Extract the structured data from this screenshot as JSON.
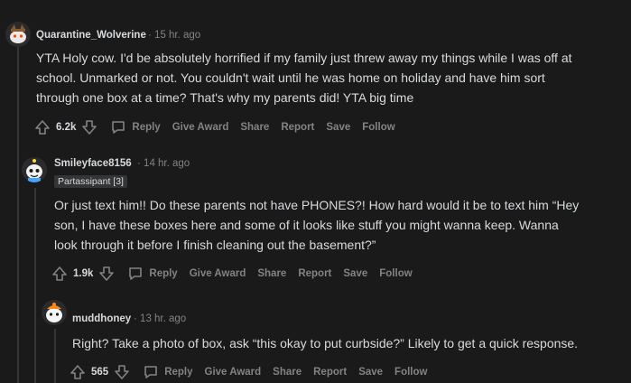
{
  "comments": [
    {
      "author": "Quarantine_Wolverine",
      "time": "15 hr. ago",
      "flair": "",
      "body_lines": [
        "YTA Holy cow. I'd be absolutely horrified if my family just threw away my things while I was off at",
        "school. Unmarked or not. You couldn't wait until he was home on holiday and have him sort",
        "through one box at a time? That's why my parents did! YTA big time"
      ],
      "score": "6.2k",
      "icons": {
        "upvote": "upvote-arrow-icon",
        "downvote": "downvote-arrow-icon",
        "reply": "chat-bubble-icon"
      },
      "actions": {
        "reply": "Reply",
        "give_award": "Give Award",
        "share": "Share",
        "report": "Report",
        "save": "Save",
        "follow": "Follow"
      }
    },
    {
      "author": "Smileyface8156",
      "time": "14 hr. ago",
      "flair": "Partassipant [3]",
      "body_lines": [
        "Or just text him!! Do these parents not have PHONES?! How hard would it be to text him “Hey",
        "son, I have these boxes here and some of it looks like stuff you might wanna keep. Wanna",
        "look through it before I finish cleaning out the basement?”"
      ],
      "score": "1.9k",
      "icons": {
        "upvote": "upvote-arrow-icon",
        "downvote": "downvote-arrow-icon",
        "reply": "chat-bubble-icon"
      },
      "actions": {
        "reply": "Reply",
        "give_award": "Give Award",
        "share": "Share",
        "report": "Report",
        "save": "Save",
        "follow": "Follow"
      }
    },
    {
      "author": "muddhoney",
      "time": "13 hr. ago",
      "flair": "",
      "body_lines": [
        "Right? Take a photo of box, ask “this okay to put curbside?” Likely to get a quick response."
      ],
      "score": "565",
      "icons": {
        "upvote": "upvote-arrow-icon",
        "downvote": "downvote-arrow-icon",
        "reply": "chat-bubble-icon"
      },
      "actions": {
        "reply": "Reply",
        "give_award": "Give Award",
        "share": "Share",
        "report": "Report",
        "save": "Save",
        "follow": "Follow"
      }
    }
  ],
  "separator": "·",
  "colors": {
    "background": "#1a1a1b",
    "text": "#d7dadc",
    "muted": "#818384",
    "thread_line": "#343536"
  }
}
